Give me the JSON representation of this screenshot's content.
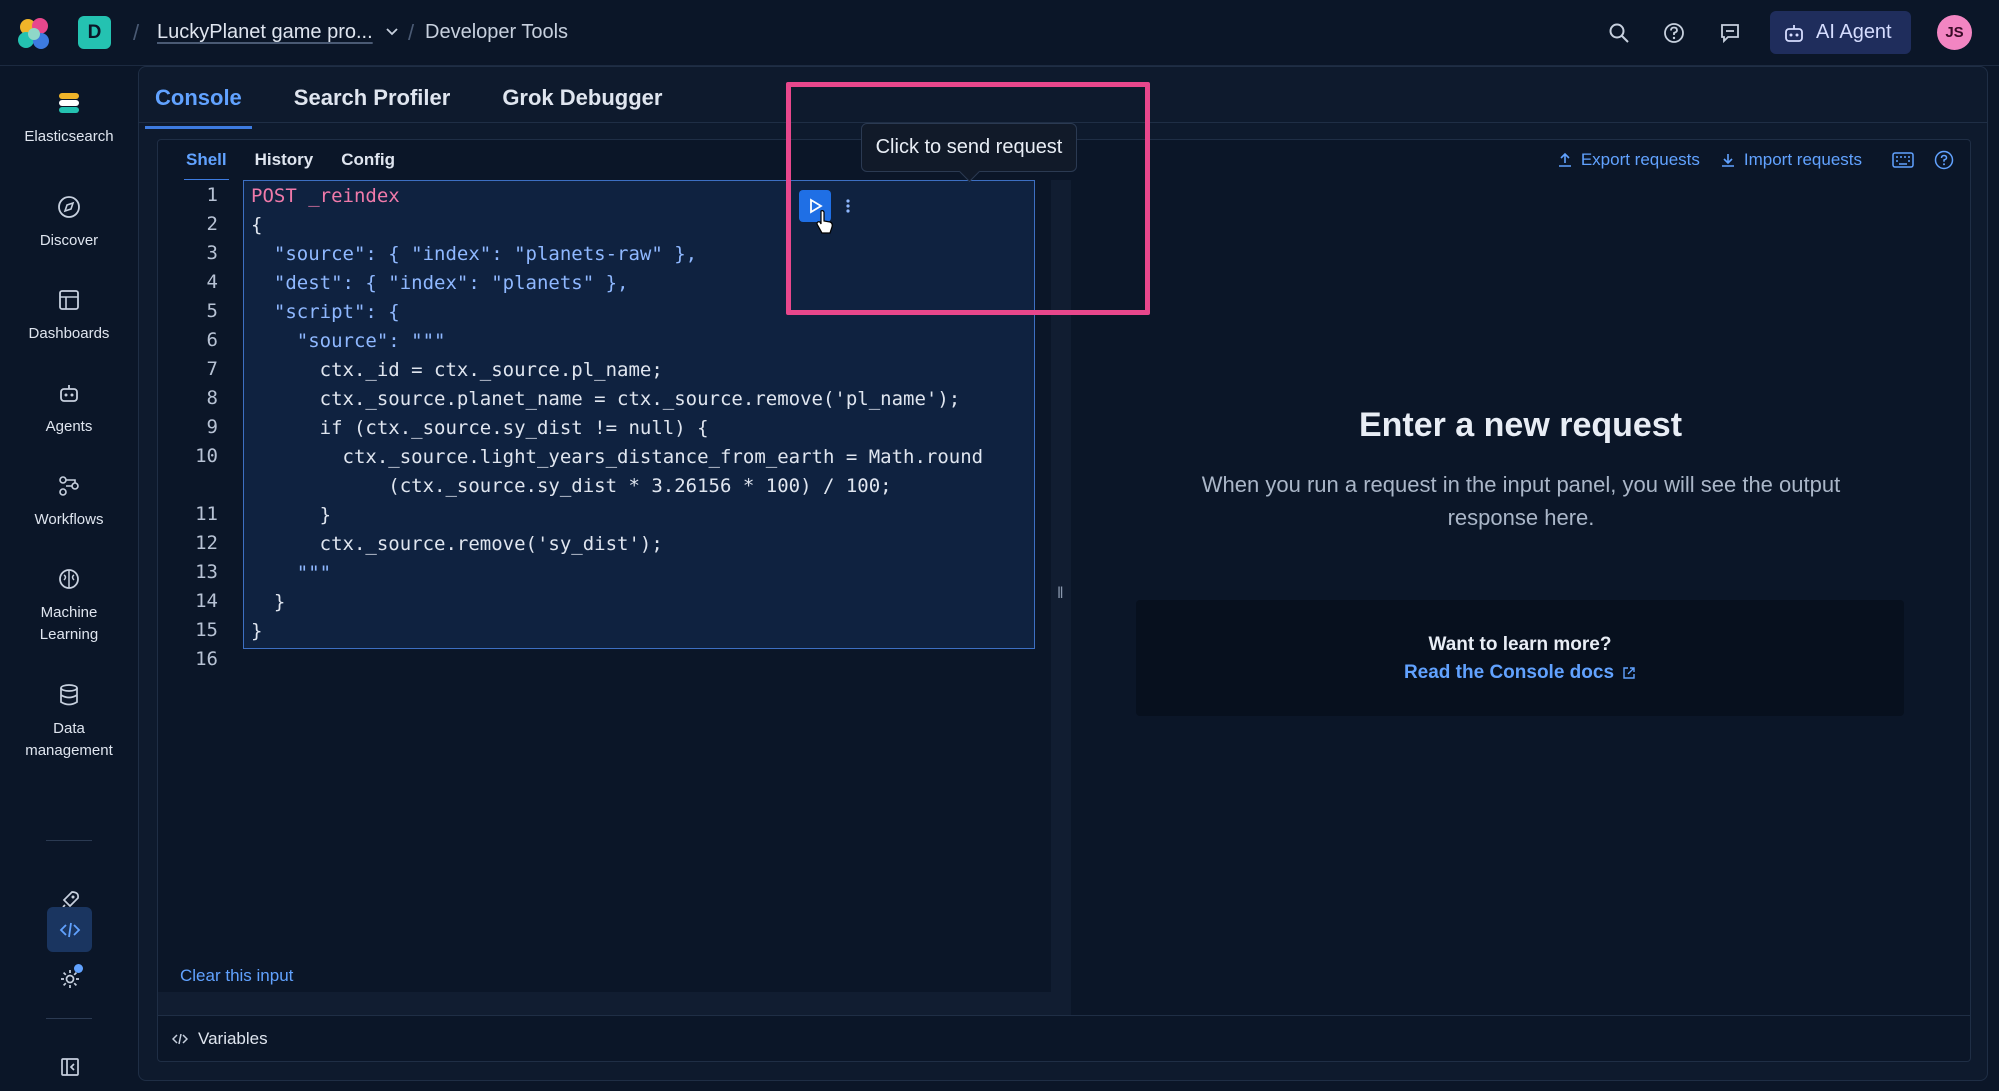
{
  "header": {
    "space_initial": "D",
    "project": "LuckyPlanet game pro...",
    "page": "Developer Tools",
    "ai_agent_label": "AI Agent",
    "avatar_initials": "JS"
  },
  "sidebar": {
    "items": [
      {
        "label": "Elasticsearch",
        "icon": "elasticsearch-icon"
      },
      {
        "label": "Discover",
        "icon": "compass-icon"
      },
      {
        "label": "Dashboards",
        "icon": "dashboard-icon"
      },
      {
        "label": "Agents",
        "icon": "robot-icon"
      },
      {
        "label": "Workflows",
        "icon": "workflow-icon"
      },
      {
        "label": "Machine Learning",
        "icon": "brain-icon"
      },
      {
        "label": "Data management",
        "icon": "database-icon"
      }
    ]
  },
  "tabs": [
    "Console",
    "Search Profiler",
    "Grok Debugger"
  ],
  "console": {
    "subtabs": [
      "Shell",
      "History",
      "Config"
    ],
    "export_label": "Export requests",
    "import_label": "Import requests",
    "clear_label": "Clear this input",
    "variables_label": "Variables",
    "tooltip": "Click to send request",
    "line_numbers": [
      "1",
      "2",
      "3",
      "4",
      "5",
      "6",
      "7",
      "8",
      "9",
      "10",
      "",
      "11",
      "12",
      "13",
      "14",
      "15",
      "16"
    ],
    "code": [
      "POST _reindex",
      "{",
      "  \"source\": { \"index\": \"planets-raw\" },",
      "  \"dest\": { \"index\": \"planets\" },",
      "  \"script\": {",
      "    \"source\": \"\"\"",
      "      ctx._id = ctx._source.pl_name;",
      "      ctx._source.planet_name = ctx._source.remove('pl_name');",
      "      if (ctx._source.sy_dist != null) {",
      "        ctx._source.light_years_distance_from_earth = Math.round",
      "            (ctx._source.sy_dist * 3.26156 * 100) / 100;",
      "      }",
      "      ctx._source.remove('sy_dist');",
      "    \"\"\"",
      "  }",
      "}",
      ""
    ]
  },
  "output": {
    "title": "Enter a new request",
    "description": "When you run a request in the input panel, you will see the output response here.",
    "learn_title": "Want to learn more?",
    "learn_link": "Read the Console docs"
  },
  "colors": {
    "accent": "#61a2ff",
    "highlight": "#e8478c",
    "background": "#0b1628"
  }
}
